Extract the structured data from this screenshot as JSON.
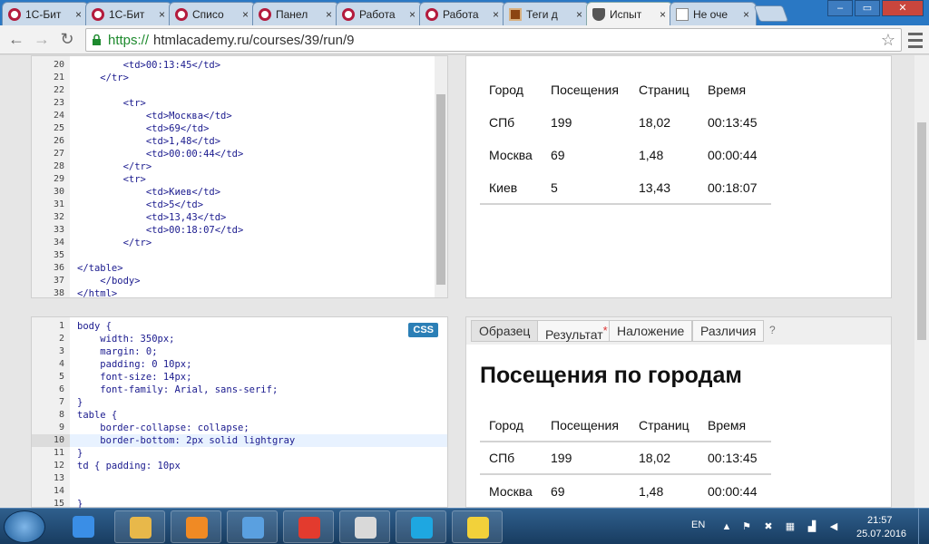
{
  "browser": {
    "tabs": [
      {
        "label": "1С-Бит",
        "icon": "bitrix-ring-icon"
      },
      {
        "label": "1С-Бит",
        "icon": "bitrix-ring-icon"
      },
      {
        "label": "Списо",
        "icon": "bitrix-ring-icon"
      },
      {
        "label": "Панел",
        "icon": "bitrix-ring-icon"
      },
      {
        "label": "Работа",
        "icon": "bitrix-ring-icon"
      },
      {
        "label": "Работа",
        "icon": "bitrix-ring-icon"
      },
      {
        "label": "Теги д",
        "icon": "brick-icon"
      },
      {
        "label": "Испыт",
        "icon": "shield-icon"
      },
      {
        "label": "Не оче",
        "icon": "document-icon"
      }
    ],
    "close_glyph": "×",
    "window_controls": {
      "minimize": "–",
      "maximize": "▭",
      "close": "✕"
    },
    "url_scheme": "https://",
    "url_rest": "htmlacademy.ru/courses/39/run/9",
    "star": "☆"
  },
  "html_editor": {
    "lines": [
      {
        "n": "20",
        "indent": "        ",
        "text": "<td>00:13:45</td>"
      },
      {
        "n": "21",
        "indent": "    ",
        "text": "</tr>"
      },
      {
        "n": "22",
        "indent": "",
        "text": ""
      },
      {
        "n": "23",
        "indent": "        ",
        "text": "<tr>"
      },
      {
        "n": "24",
        "indent": "            ",
        "text": "<td>Москва</td>"
      },
      {
        "n": "25",
        "indent": "            ",
        "text": "<td>69</td>"
      },
      {
        "n": "26",
        "indent": "            ",
        "text": "<td>1,48</td>"
      },
      {
        "n": "27",
        "indent": "            ",
        "text": "<td>00:00:44</td>"
      },
      {
        "n": "28",
        "indent": "        ",
        "text": "</tr>"
      },
      {
        "n": "29",
        "indent": "        ",
        "text": "<tr>"
      },
      {
        "n": "30",
        "indent": "            ",
        "text": "<td>Киев</td>"
      },
      {
        "n": "31",
        "indent": "            ",
        "text": "<td>5</td>"
      },
      {
        "n": "32",
        "indent": "            ",
        "text": "<td>13,43</td>"
      },
      {
        "n": "33",
        "indent": "            ",
        "text": "<td>00:18:07</td>"
      },
      {
        "n": "34",
        "indent": "        ",
        "text": "</tr>"
      },
      {
        "n": "35",
        "indent": "",
        "text": ""
      },
      {
        "n": "36",
        "indent": "",
        "text": "</table>"
      },
      {
        "n": "37",
        "indent": "    ",
        "text": "</body>"
      },
      {
        "n": "38",
        "indent": "",
        "text": "</html>"
      }
    ]
  },
  "css_editor": {
    "badge": "CSS",
    "lines": [
      {
        "n": "1",
        "indent": "",
        "text": "body {"
      },
      {
        "n": "2",
        "indent": "    ",
        "text": "width: 350px;"
      },
      {
        "n": "3",
        "indent": "    ",
        "text": "margin: 0;"
      },
      {
        "n": "4",
        "indent": "    ",
        "text": "padding: 0 10px;"
      },
      {
        "n": "5",
        "indent": "    ",
        "text": "font-size: 14px;"
      },
      {
        "n": "6",
        "indent": "    ",
        "text": "font-family: Arial, sans-serif;"
      },
      {
        "n": "7",
        "indent": "",
        "text": "}"
      },
      {
        "n": "8",
        "indent": "",
        "text": "table {"
      },
      {
        "n": "9",
        "indent": "    ",
        "text": "border-collapse: collapse;"
      },
      {
        "n": "10",
        "indent": "    ",
        "text": "border-bottom: 2px solid lightgray"
      },
      {
        "n": "11",
        "indent": "",
        "text": "}"
      },
      {
        "n": "12",
        "indent": "",
        "text": "td { padding: 10px"
      },
      {
        "n": "13",
        "indent": "",
        "text": ""
      },
      {
        "n": "14",
        "indent": "",
        "text": ""
      },
      {
        "n": "15",
        "indent": "",
        "text": "}"
      }
    ],
    "current_line": "10"
  },
  "result_top": {
    "rows": [
      [
        "Город",
        "Посещения",
        "Страниц",
        "Время"
      ],
      [
        "СПб",
        "199",
        "18,02",
        "00:13:45"
      ],
      [
        "Москва",
        "69",
        "1,48",
        "00:00:44"
      ],
      [
        "Киев",
        "5",
        "13,43",
        "00:18:07"
      ]
    ],
    "border_color": "#d3d3d3"
  },
  "result_bottom": {
    "tabs": [
      {
        "label": "Образец",
        "active": true
      },
      {
        "label": "Результат",
        "star": "*"
      },
      {
        "label": "Наложение"
      },
      {
        "label": "Различия"
      }
    ],
    "help": "?",
    "title": "Посещения по городам",
    "rows": [
      [
        "Город",
        "Посещения",
        "Страниц",
        "Время"
      ],
      [
        "СПб",
        "199",
        "18,02",
        "00:13:45"
      ],
      [
        "Москва",
        "69",
        "1,48",
        "00:00:44"
      ]
    ]
  },
  "taskbar": {
    "apps": [
      {
        "name": "internet-explorer-icon",
        "color": "#3a8ee6"
      },
      {
        "name": "file-explorer-icon",
        "color": "#e8b84a"
      },
      {
        "name": "media-player-icon",
        "color": "#f08a24"
      },
      {
        "name": "audio-app-icon",
        "color": "#5aa0e0"
      },
      {
        "name": "yandex-browser-icon",
        "color": "#e33b2e"
      },
      {
        "name": "chrome-icon",
        "color": "#d9d9d9"
      },
      {
        "name": "skype-icon",
        "color": "#1ea7e1"
      },
      {
        "name": "help-documents-icon",
        "color": "#f2d13a"
      }
    ],
    "language": "EN",
    "time": "21:57",
    "date": "25.07.2016"
  }
}
